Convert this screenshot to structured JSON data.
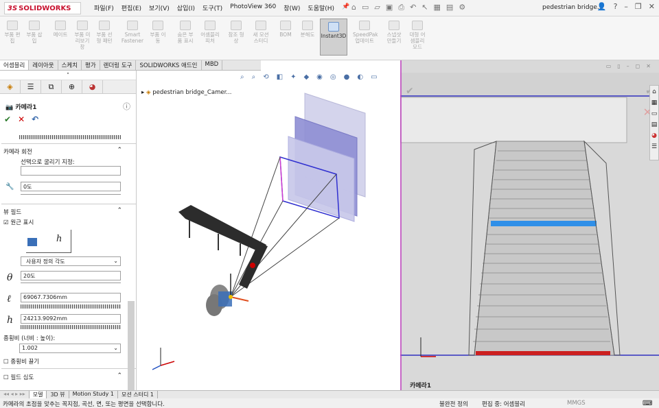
{
  "app": {
    "logo": "SOLIDWORKS",
    "logo_mark": "3S"
  },
  "menu": [
    "파일(F)",
    "편집(E)",
    "보기(V)",
    "삽입(I)",
    "도구(T)",
    "PhotoView 360",
    "창(W)",
    "도움말(H)"
  ],
  "document_title": "pedestrian bridge...",
  "ribbon": [
    {
      "label": "부품 편집"
    },
    {
      "label": "부품 삽입"
    },
    {
      "label": "메이트"
    },
    {
      "label": "부품 미리보기 창"
    },
    {
      "label": "부품 선형 패턴"
    },
    {
      "label": "Smart Fastener"
    },
    {
      "label": "부품 이동"
    },
    {
      "label": "숨은 부품 표시"
    },
    {
      "label": "어셈블리 피처"
    },
    {
      "label": "참조 형상"
    },
    {
      "label": "새 모션 스터디"
    },
    {
      "label": "BOM"
    },
    {
      "label": "분해도"
    },
    {
      "label": "Instant3D"
    },
    {
      "label": "SpeedPak 업데이트"
    },
    {
      "label": "스냅샷 만들기"
    },
    {
      "label": "대형 어셈블리 모드"
    }
  ],
  "command_tabs": [
    "어셈블리",
    "레이아웃",
    "스케치",
    "평가",
    "렌더링 도구",
    "SOLIDWORKS 애드인",
    "MBD"
  ],
  "panel": {
    "title": "카메라1",
    "camera_rotation_header": "카메라 회전",
    "select_label": "선택으로 굴리기 지정:",
    "roll_value": "0도",
    "field_of_view_header": "뷰 필드",
    "perspective_label": "원근 표시",
    "angle_select": "사용자 정의 각도",
    "theta_value": "20도",
    "l_value": "69067.7306mm",
    "h_value": "24213.9092mm",
    "aspect_label": "종횡비 (너비 : 높이):",
    "aspect_value": "1.002",
    "aspect_drag_label": "종횡비 끌기",
    "depth_of_field_label": "필드 심도"
  },
  "tree": {
    "root": "pedestrian bridge_Camer..."
  },
  "right_view": {
    "label": "카메라1"
  },
  "bottom_tabs": [
    "모델",
    "3D 뷰",
    "Motion Study 1",
    "모션 스터디 1"
  ],
  "status": {
    "message": "카메라의 초점을 맞추는 꼭지점, 곡선, 면, 또는 평면을 선택합니다.",
    "state": "불완전 정의",
    "editing": "편집 중: 어셈블리",
    "units": "MMGS"
  }
}
